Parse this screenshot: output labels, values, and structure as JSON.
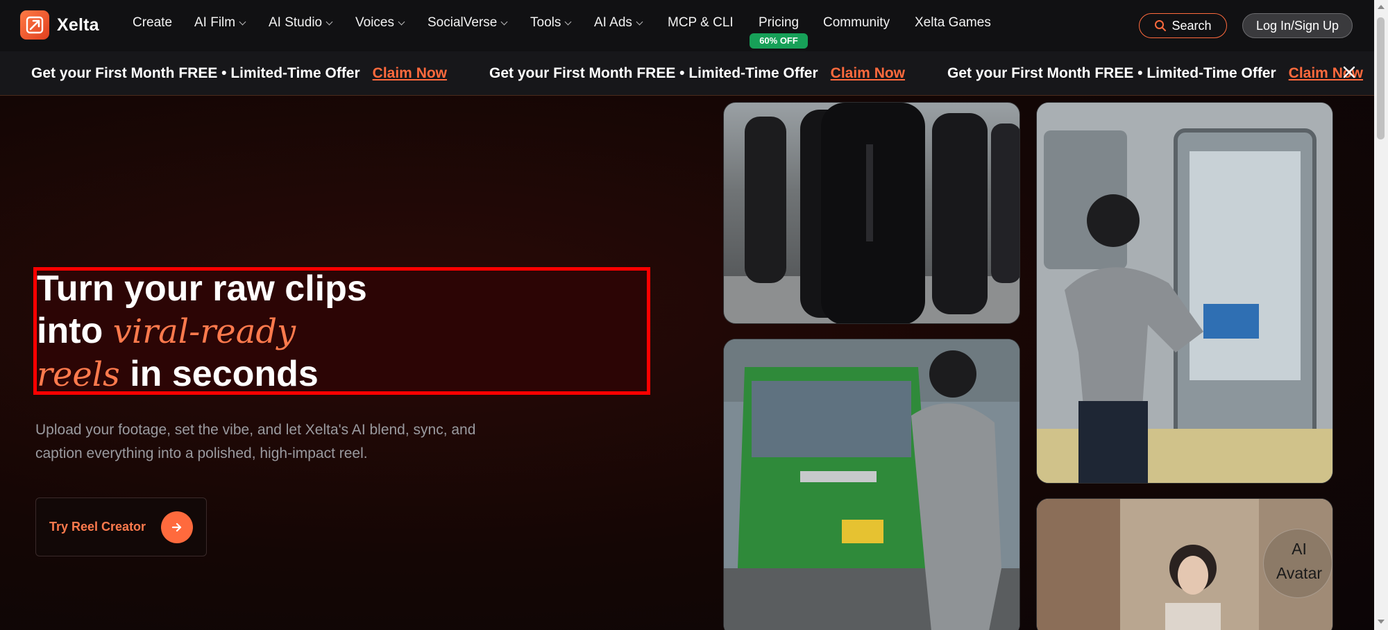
{
  "brand": {
    "name": "Xelta"
  },
  "nav": {
    "items": [
      {
        "label": "Create",
        "dropdown": false
      },
      {
        "label": "AI Film",
        "dropdown": true
      },
      {
        "label": "AI Studio",
        "dropdown": true
      },
      {
        "label": "Voices",
        "dropdown": true
      },
      {
        "label": "SocialVerse",
        "dropdown": true
      },
      {
        "label": "Tools",
        "dropdown": true
      },
      {
        "label": "AI Ads",
        "dropdown": true
      },
      {
        "label": "MCP & CLI",
        "dropdown": false
      },
      {
        "label": "Pricing",
        "dropdown": false
      },
      {
        "label": "Community",
        "dropdown": false
      },
      {
        "label": "Xelta Games",
        "dropdown": false
      }
    ],
    "pricing_badge": "60% OFF",
    "search_label": "Search",
    "login_label": "Log In/Sign Up"
  },
  "promo": {
    "text": "Get your First Month FREE • Limited-Time Offer",
    "claim": "Claim Now"
  },
  "hero": {
    "line1": "Turn your raw clips",
    "line2_plain": "into ",
    "line2_italic": "viral-ready",
    "line3_italic": "reels",
    "line3_plain": " in seconds",
    "subtext": "Upload your footage, set the vibe, and let Xelta's AI blend, sync, and caption everything into a polished, high-impact reel.",
    "cta_label": "Try Reel Creator"
  },
  "avatar_bubble": {
    "label": "AI Avatar"
  },
  "colors": {
    "accent": "#ff6a3d",
    "highlight_border": "#ff0000",
    "badge_green": "#17a058",
    "nav_bg": "#111113"
  }
}
